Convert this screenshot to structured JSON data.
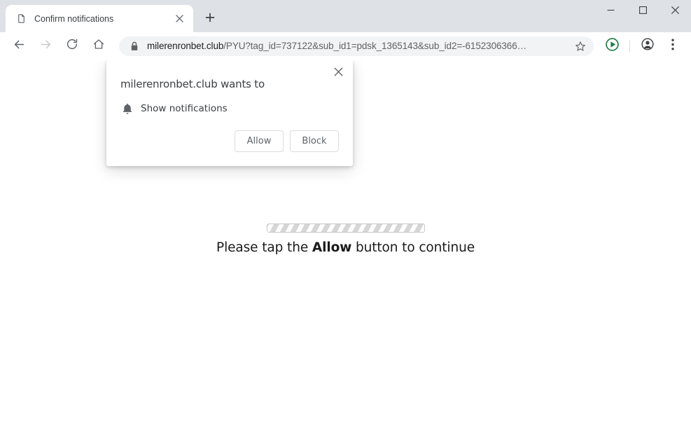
{
  "window": {
    "controls": {
      "minimize": "minimize-window",
      "maximize": "maximize-window",
      "close": "close-window"
    }
  },
  "tabstrip": {
    "tabs": [
      {
        "title": "Confirm notifications",
        "favicon": "generic-page-icon",
        "close_label": "close-tab",
        "active": true
      }
    ],
    "new_tab_label": "new-tab"
  },
  "toolbar": {
    "back_label": "Back",
    "forward_label": "Forward",
    "reload_label": "Reload",
    "home_label": "Home",
    "bookmark_label": "Bookmark this tab",
    "extension_label": "extension-play-button",
    "profile_label": "Profile",
    "menu_label": "Customize and control Google Chrome",
    "accent_green": "#1e7b45"
  },
  "omnibox": {
    "security_icon": "lock-icon",
    "host": "milerenronbet.club",
    "path": "/PYU?tag_id=737122&sub_id1=pdsk_1365143&sub_id2=-6152306366…",
    "full_url": "milerenronbet.club/PYU?tag_id=737122&sub_id1=pdsk_1365143&sub_id2=-6152306366…"
  },
  "permission_dialog": {
    "title": "milerenronbet.club wants to",
    "permission_icon": "bell-icon",
    "permission_label": "Show notifications",
    "allow_label": "Allow",
    "block_label": "Block",
    "close_label": "close-dialog"
  },
  "page": {
    "progress_bar_label": "loading-progress",
    "message_prefix": "Please tap the ",
    "message_emphasis": "Allow",
    "message_suffix": " button to continue"
  }
}
